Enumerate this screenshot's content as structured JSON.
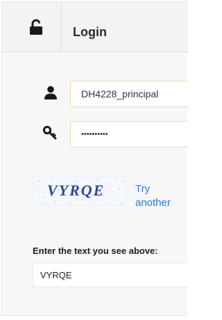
{
  "header": {
    "title": "Login",
    "icon": "unlocked-padlock-icon"
  },
  "form": {
    "username": {
      "icon": "user-icon",
      "value": "DH4228_principal"
    },
    "password": {
      "icon": "key-icon",
      "masked_value": "••••••••••"
    },
    "captcha": {
      "image_text": "VYRQE",
      "refresh_label": "Try another",
      "prompt": "Enter the text you see above:",
      "input_value": "VYRQE"
    }
  },
  "colors": {
    "link": "#2a7bd1",
    "captcha_text": "#33449a",
    "field_border": "#f0d9b5"
  }
}
